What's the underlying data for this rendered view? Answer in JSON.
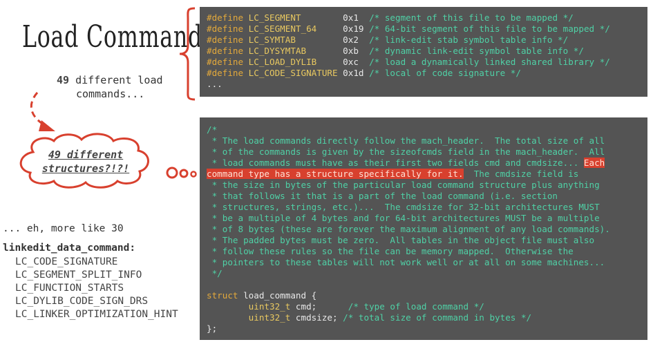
{
  "title": "Load Commands",
  "count_note": {
    "number": "49",
    "line1": "different load",
    "line2": "commands..."
  },
  "defines": [
    {
      "kw": "#define",
      "name": "LC_SEGMENT",
      "value": "0x1",
      "comment": "/* segment of this file to be mapped */"
    },
    {
      "kw": "#define",
      "name": "LC_SEGMENT_64",
      "value": "0x19",
      "comment": "/* 64-bit segment of this file to be mapped */"
    },
    {
      "kw": "#define",
      "name": "LC_SYMTAB",
      "value": "0x2",
      "comment": "/* link-edit stab symbol table info */"
    },
    {
      "kw": "#define",
      "name": "LC_DYSYMTAB",
      "value": "0xb",
      "comment": "/* dynamic link-edit symbol table info */"
    },
    {
      "kw": "#define",
      "name": "LC_LOAD_DYLIB",
      "value": "0xc",
      "comment": "/* load a dynamically linked shared library */"
    },
    {
      "kw": "#define",
      "name": "LC_CODE_SIGNATURE",
      "value": "0x1d",
      "comment": "/* local of code signature */"
    }
  ],
  "defines_ellipsis": "...",
  "cloud_text": {
    "line1": "49 different",
    "line2": "structures?!?!"
  },
  "comment_block": {
    "open": "/*",
    "lines": [
      " * The load commands directly follow the mach_header.  The total size of all",
      " * of the commands is given by the sizeofcmds field in the mach_header.  All",
      " * load commands must have as their first two fields cmd and cmdsize... ",
      "command type has a structure specifically for it.",
      "  The cmdsize field is",
      " * the size in bytes of the particular load command structure plus anything",
      " * that follows it that is a part of the load command (i.e. section",
      " * structures, strings, etc.)...  The cmdsize for 32-bit architectures MUST",
      " * be a multiple of 4 bytes and for 64-bit architectures MUST be a multiple",
      " * of 8 bytes (these are forever the maximum alignment of any load commands).",
      " * The padded bytes must be zero.  All tables in the object file must also",
      " * follow these rules so the file can be memory mapped.  Otherwise the",
      " * pointers to these tables will not work well or at all on some machines...",
      " */"
    ],
    "highlight_start": "Each",
    "highlight_prefix": " * "
  },
  "struct": {
    "kw": "struct",
    "name": "load_command {",
    "fields": [
      {
        "type": "uint32_t",
        "name": "cmd;",
        "pad": "      ",
        "comment": "/* type of load command */"
      },
      {
        "type": "uint32_t",
        "name": "cmdsize;",
        "pad": " ",
        "comment": "/* total size of command in bytes */"
      }
    ],
    "close": "};"
  },
  "more_note": "... eh, more like 30",
  "linkedit": {
    "heading": "linkedit_data_command:",
    "items": [
      "LC_CODE_SIGNATURE",
      "LC_SEGMENT_SPLIT_INFO",
      "LC_FUNCTION_STARTS",
      "LC_DYLIB_CODE_SIGN_DRS",
      "LC_LINKER_OPTIMIZATION_HINT"
    ]
  },
  "colors": {
    "code_bg": "#545454",
    "keyword": "#e3a93b",
    "comment": "#4fd1a6",
    "highlight": "#d8402e",
    "accent_red": "#d8402e"
  }
}
